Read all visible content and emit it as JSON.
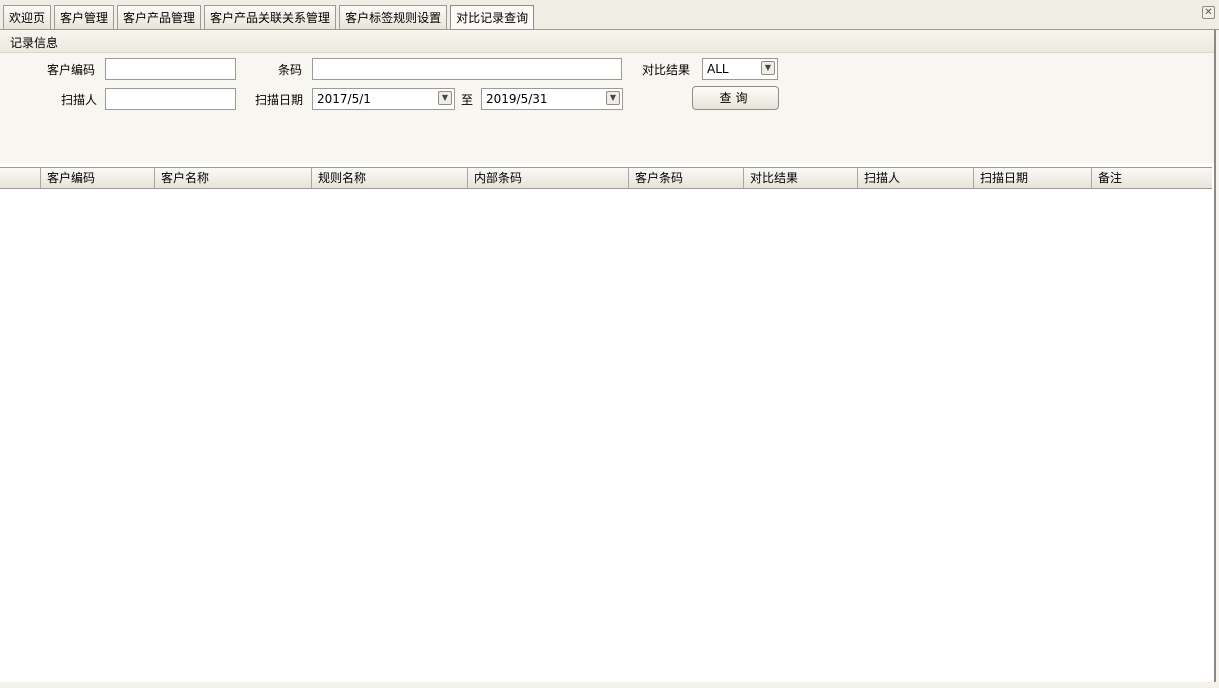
{
  "tabs": [
    {
      "label": "欢迎页"
    },
    {
      "label": "客户管理"
    },
    {
      "label": "客户产品管理"
    },
    {
      "label": "客户产品关联关系管理"
    },
    {
      "label": "客户标签规则设置"
    },
    {
      "label": "对比记录查询"
    }
  ],
  "close_icon": "close-icon",
  "section_title": "记录信息",
  "form": {
    "customer_code_label": "客户编码",
    "customer_code_value": "",
    "barcode_label": "条码",
    "barcode_value": "",
    "result_label": "对比结果",
    "result_value": "ALL",
    "scanner_label": "扫描人",
    "scanner_value": "",
    "scan_date_label": "扫描日期",
    "date_from": "2017/5/1",
    "to_label": "至",
    "date_to": "2019/5/31",
    "query_button": "查询"
  },
  "table": {
    "columns": [
      "",
      "客户编码",
      "客户名称",
      "规则名称",
      "内部条码",
      "客户条码",
      "对比结果",
      "扫描人",
      "扫描日期",
      "备注"
    ],
    "rows": []
  }
}
